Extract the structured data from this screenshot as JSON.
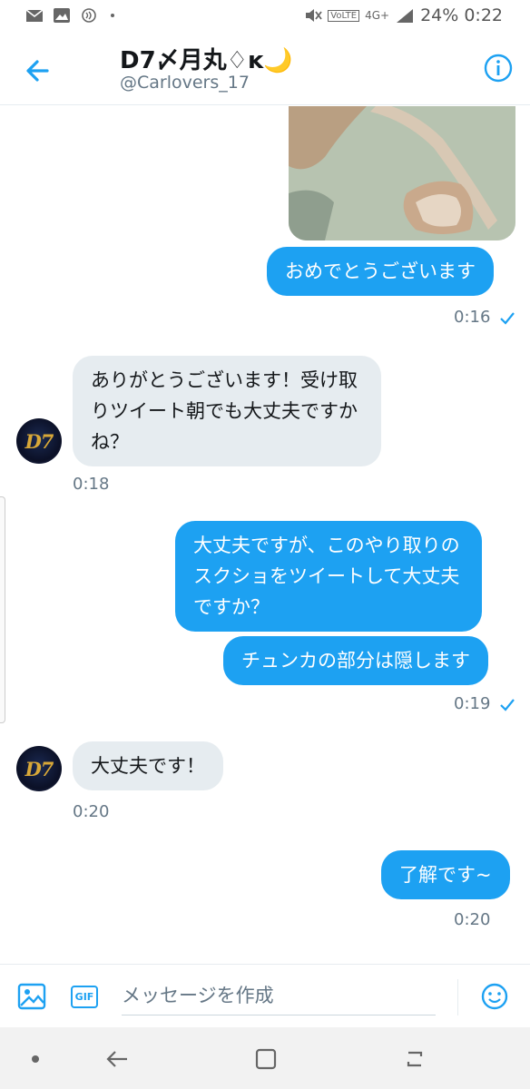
{
  "status_bar": {
    "battery": "24%",
    "time": "0:22",
    "network": "4G+",
    "volte": "VoLTE"
  },
  "header": {
    "name": "D7〆月丸♢ĸ🌙",
    "handle": "@Carlovers_17"
  },
  "messages": [
    {
      "type": "sent",
      "text": "おめでとうございます"
    },
    {
      "type": "sent_time",
      "text": "0:16"
    },
    {
      "type": "recv",
      "lines": [
        "ありがとうございます！受け取",
        "りツイート朝でも大丈夫ですか",
        "ね？"
      ]
    },
    {
      "type": "recv_time",
      "text": "0:18"
    },
    {
      "type": "sent",
      "lines": [
        "大丈夫ですが、このやり取りの",
        "スクショをツイートして大丈夫",
        "ですか？"
      ]
    },
    {
      "type": "sent",
      "text": "チュンカの部分は隠します"
    },
    {
      "type": "sent_time",
      "text": "0:19"
    },
    {
      "type": "recv",
      "text": "大丈夫です！"
    },
    {
      "type": "recv_time",
      "text": "0:20"
    },
    {
      "type": "sent",
      "text": "了解です~"
    },
    {
      "type": "sent_time",
      "text": "0:20"
    }
  ],
  "avatar": {
    "text": "D7"
  },
  "composer": {
    "placeholder": "メッセージを作成",
    "gif_label": "GIF"
  },
  "colors": {
    "accent": "#1da1f2",
    "received_bubble": "#e6ecf0",
    "muted_text": "#657786"
  },
  "icons": {
    "back": "arrow-left-icon",
    "info": "info-icon",
    "photo": "image-icon",
    "gif": "gif-icon",
    "emoji": "smiley-icon",
    "read_check": "check-icon"
  }
}
